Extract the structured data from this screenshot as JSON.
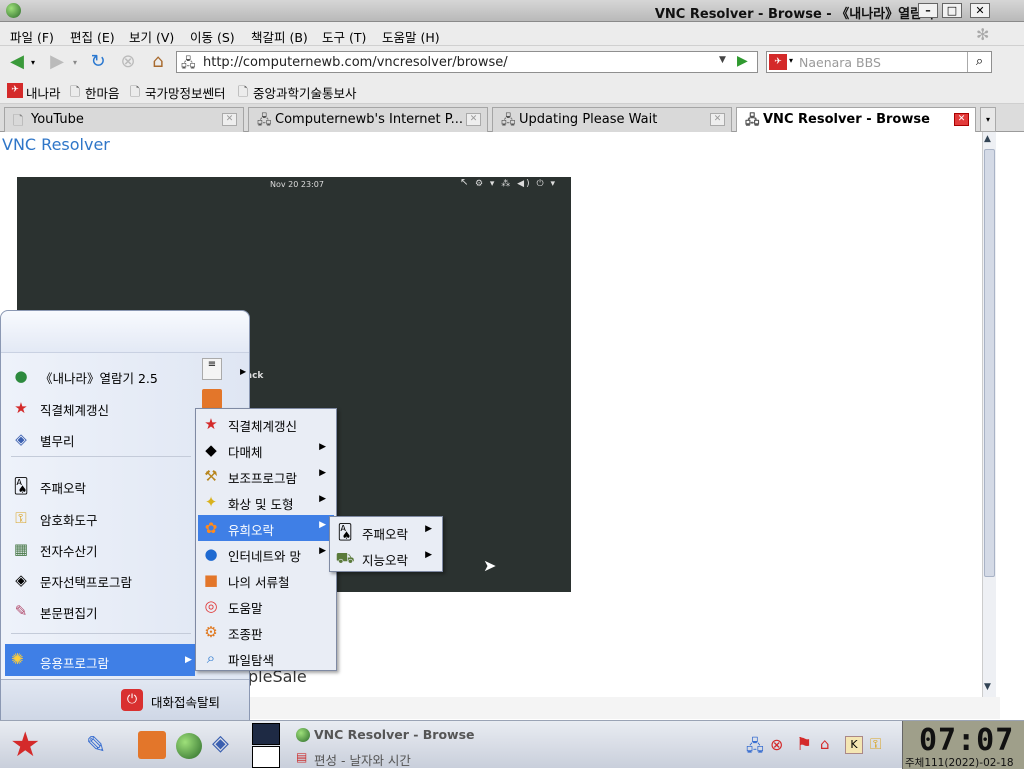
{
  "window": {
    "title": "VNC Resolver - Browse - 《내나라》열람기"
  },
  "menubar": [
    "파일 (F)",
    "편집 (E)",
    "보기 (V)",
    "이동 (S)",
    "책갈피 (B)",
    "도구 (T)",
    "도움말 (H)"
  ],
  "navbar": {
    "url": "http://computernewb.com/vncresolver/browse/",
    "search_placeholder": "Naenara BBS"
  },
  "bookmarks": [
    "내나라",
    "한마음",
    "국가망정보쎈터",
    "중앙과학기술통보사"
  ],
  "tabs": [
    {
      "label": "YouTube",
      "active": false
    },
    {
      "label": "Computernewb's Internet P...",
      "active": false
    },
    {
      "label": "Updating Please Wait",
      "active": false
    },
    {
      "label": "VNC Resolver - Browse",
      "active": true
    }
  ],
  "page": {
    "heading": "VNC Resolver",
    "partial_text": "pleSale",
    "partial_ack": "ack"
  },
  "vnc_screen": {
    "clock": "Nov 20 23:07"
  },
  "start_menu": {
    "top_items": [
      "《내나라》열람기 2.5",
      "직결체계갱신",
      "별무리"
    ],
    "mid_items": [
      "주패오락",
      "암호화도구",
      "전자수산기",
      "문자선택프로그람",
      "본문편집기"
    ],
    "apps_label": "응용프로그람",
    "logout_label": "대화접속탈퇴"
  },
  "submenu1": [
    "직결체계갱신",
    "다매체",
    "보조프로그람",
    "화상 및 도형",
    "유희오락",
    "인터네트와 망",
    "나의 서류철",
    "도움말",
    "조종판",
    "파일탐색"
  ],
  "submenu2": [
    "주패오락",
    "지능오락"
  ],
  "taskbar": {
    "tasks": [
      "VNC Resolver - Browse",
      "편성 - 날자와 시간"
    ],
    "clock": "07:07",
    "date": "주체111(2022)-02-18"
  },
  "colors": {
    "accent": "#3f7fe6",
    "link": "#2f76c8",
    "vnc_bg": "#2b3230"
  }
}
